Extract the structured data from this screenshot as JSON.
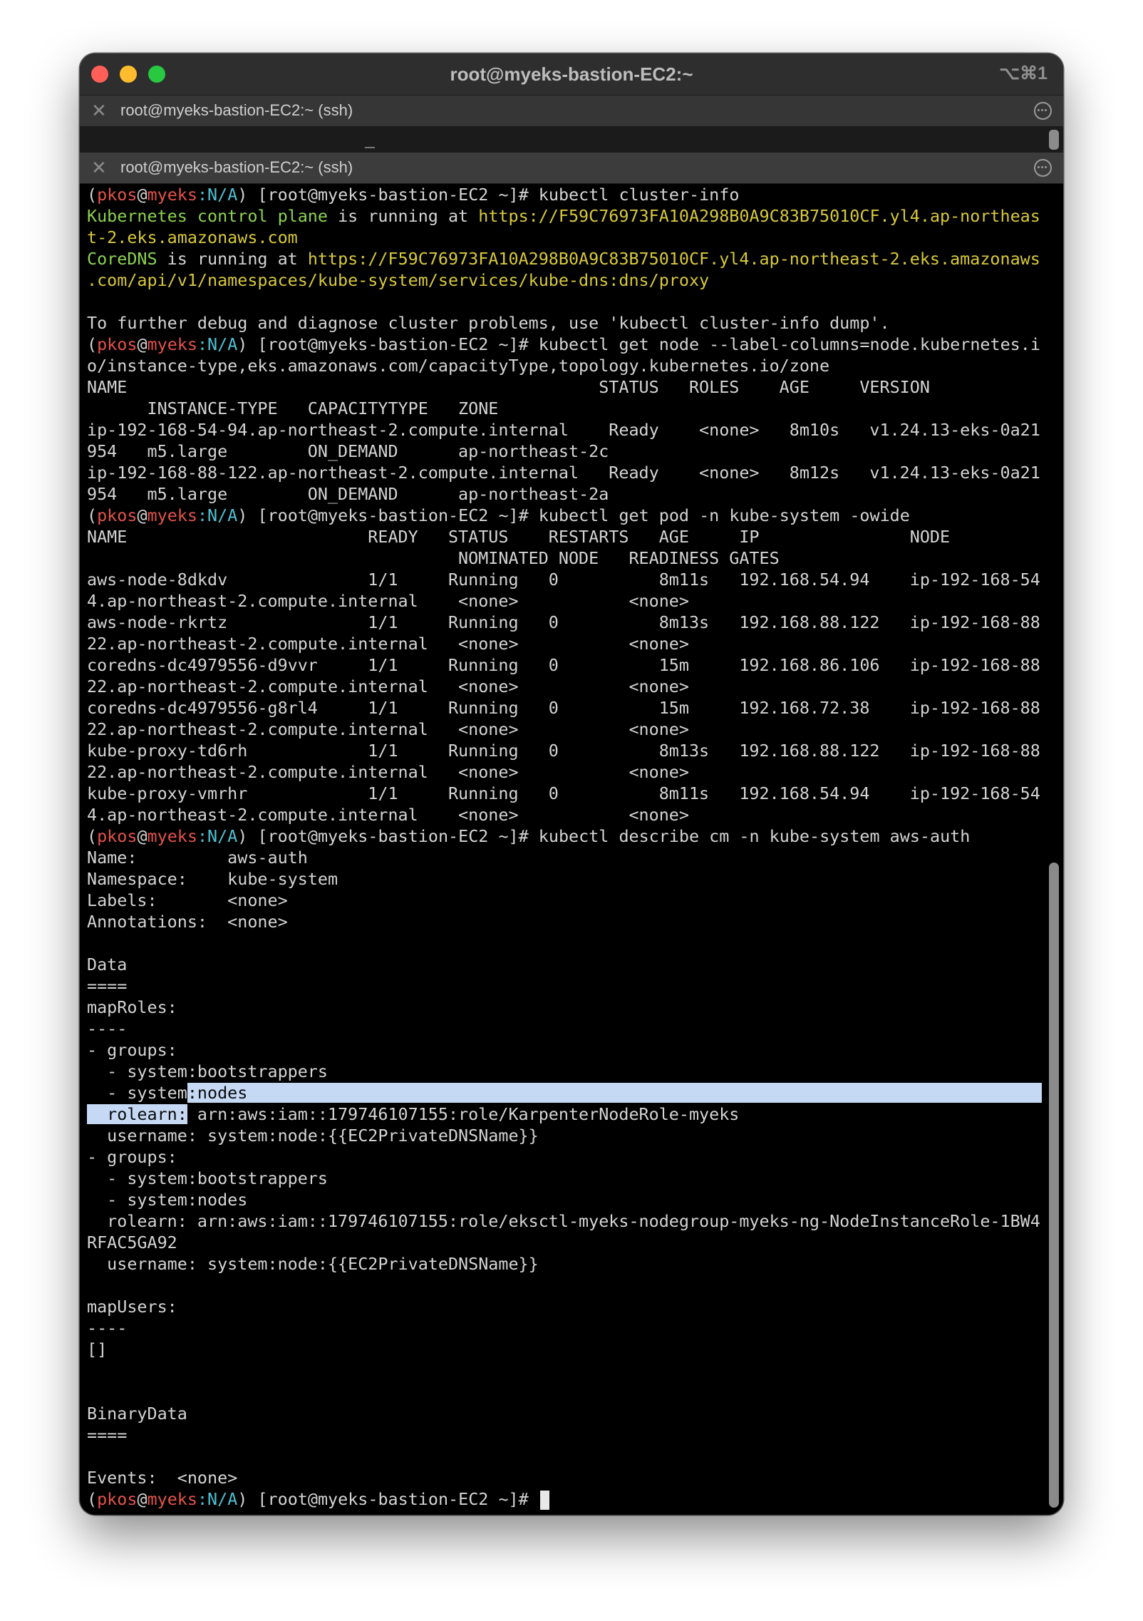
{
  "window": {
    "title": "root@myeks-bastion-EC2:~",
    "shortcut": "⌥⌘1"
  },
  "tabs": [
    {
      "title": "root@myeks-bastion-EC2:~ (ssh)"
    },
    {
      "title": "root@myeks-bastion-EC2:~ (ssh)"
    }
  ],
  "prompt": {
    "user": "pkos",
    "at": "@",
    "host": "myeks",
    "context": ":N/A",
    "open": "(",
    "close": ")",
    "shell": " [root@myeks-bastion-EC2 ~]# "
  },
  "terminal": {
    "cmd1": "kubectl cluster-info",
    "ci_l1_a": "Kubernetes control plane",
    "ci_l1_b": " is running at ",
    "ci_l1_c": "https://F59C76973FA10A298B0A9C83B75010CF.yl4.ap-northeas",
    "ci_l2": "t-2.eks.amazonaws.com",
    "ci_l3_a": "CoreDNS",
    "ci_l3_b": " is running at ",
    "ci_l3_c": "https://F59C76973FA10A298B0A9C83B75010CF.yl4.ap-northeast-2.eks.amazonaws",
    "ci_l4": ".com/api/v1/namespaces/kube-system/services/kube-dns:dns/proxy",
    "ci_l5": "",
    "ci_l6": "To further debug and diagnose cluster problems, use 'kubectl cluster-info dump'.",
    "cmd2": "kubectl get node --label-columns=node.kubernetes.i",
    "node_l1": "o/instance-type,eks.amazonaws.com/capacityType,topology.kubernetes.io/zone",
    "node_l2": "NAME                                               STATUS   ROLES    AGE     VERSION",
    "node_l3": "      INSTANCE-TYPE   CAPACITYTYPE   ZONE",
    "node_l4": "ip-192-168-54-94.ap-northeast-2.compute.internal    Ready    <none>   8m10s   v1.24.13-eks-0a21",
    "node_l5": "954   m5.large        ON_DEMAND      ap-northeast-2c",
    "node_l6": "ip-192-168-88-122.ap-northeast-2.compute.internal   Ready    <none>   8m12s   v1.24.13-eks-0a21",
    "node_l7": "954   m5.large        ON_DEMAND      ap-northeast-2a",
    "cmd3": "kubectl get pod -n kube-system -owide",
    "pod_l1": "NAME                        READY   STATUS    RESTARTS   AGE     IP               NODE",
    "pod_l2": "                                     NOMINATED NODE   READINESS GATES",
    "pod_l3": "aws-node-8dkdv              1/1     Running   0          8m11s   192.168.54.94    ip-192-168-54-9",
    "pod_l4": "4.ap-northeast-2.compute.internal    <none>           <none>",
    "pod_l5": "aws-node-rkrtz              1/1     Running   0          8m13s   192.168.88.122   ip-192-168-88-1",
    "pod_l6": "22.ap-northeast-2.compute.internal   <none>           <none>",
    "pod_l7": "coredns-dc4979556-d9vvr     1/1     Running   0          15m     192.168.86.106   ip-192-168-88-1",
    "pod_l8": "22.ap-northeast-2.compute.internal   <none>           <none>",
    "pod_l9": "coredns-dc4979556-g8rl4     1/1     Running   0          15m     192.168.72.38    ip-192-168-88-1",
    "pod_l10": "22.ap-northeast-2.compute.internal   <none>           <none>",
    "pod_l11": "kube-proxy-td6rh            1/1     Running   0          8m13s   192.168.88.122   ip-192-168-88-1",
    "pod_l12": "22.ap-northeast-2.compute.internal   <none>           <none>",
    "pod_l13": "kube-proxy-vmrhr            1/1     Running   0          8m11s   192.168.54.94    ip-192-168-54-9",
    "pod_l14": "4.ap-northeast-2.compute.internal    <none>           <none>",
    "cmd4": "kubectl describe cm -n kube-system aws-auth",
    "cm_l1": "Name:         aws-auth",
    "cm_l2": "Namespace:    kube-system",
    "cm_l3": "Labels:       <none>",
    "cm_l4": "Annotations:  <none>",
    "cm_l5": "",
    "cm_l6": "Data",
    "cm_l7": "====",
    "cm_l8": "mapRoles:",
    "cm_l9": "----",
    "cm_l10": "- groups:",
    "cm_l11": "  - system:bootstrappers",
    "cm_l12_a": "  - system",
    "cm_l12_b": ":nodes",
    "cm_l13_a": "  rolearn:",
    "cm_l13_b": " arn:aws:iam::179746107155:role/KarpenterNodeRole-myeks",
    "cm_l14": "  username: system:node:{{EC2PrivateDNSName}}",
    "cm_l15": "- groups:",
    "cm_l16": "  - system:bootstrappers",
    "cm_l17": "  - system:nodes",
    "cm_l18": "  rolearn: arn:aws:iam::179746107155:role/eksctl-myeks-nodegroup-myeks-ng-NodeInstanceRole-1BW4",
    "cm_l19": "RFAC5GA92",
    "cm_l20": "  username: system:node:{{EC2PrivateDNSName}}",
    "cm_l21": "",
    "cm_l22": "mapUsers:",
    "cm_l23": "----",
    "cm_l24": "[]",
    "cm_l25": "",
    "cm_l26": "",
    "cm_l27": "BinaryData",
    "cm_l28": "====",
    "cm_l29": "",
    "cm_l30": "Events:  <none>"
  }
}
